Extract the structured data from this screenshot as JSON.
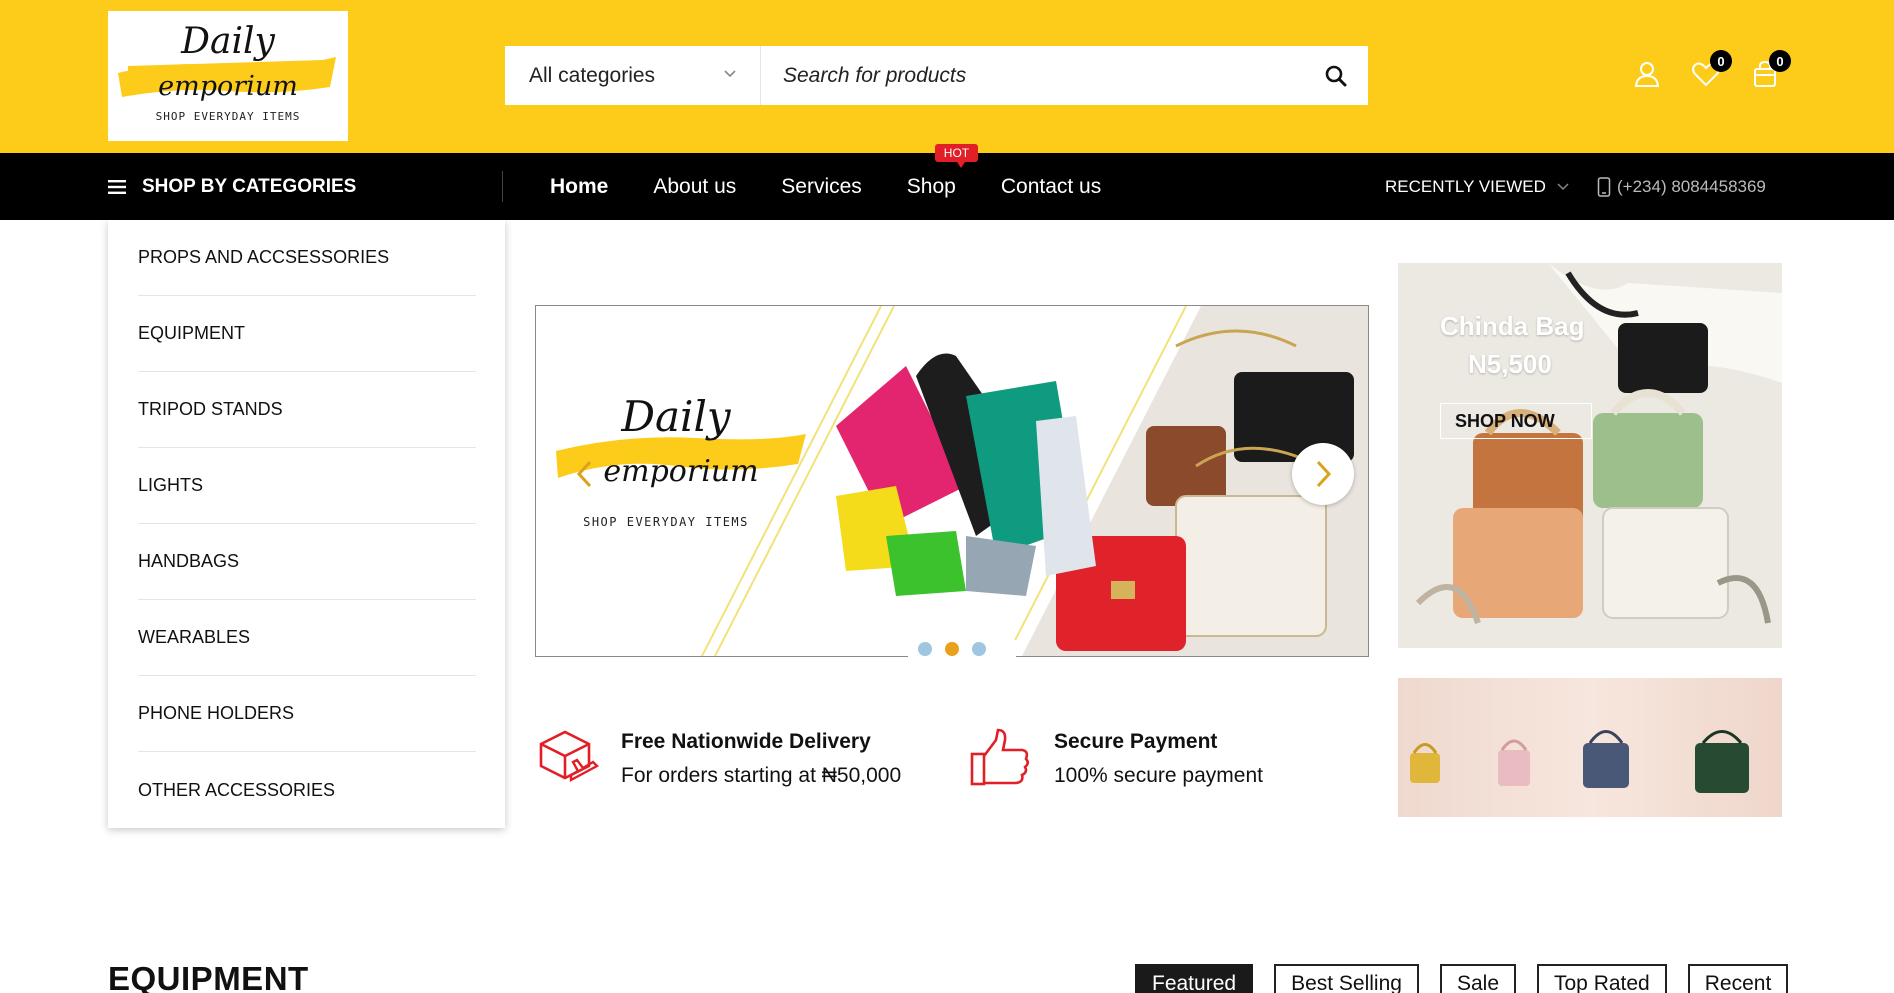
{
  "header": {
    "logo": {
      "line1": "Daily",
      "line2": "emporium",
      "tagline": "SHOP EVERYDAY ITEMS"
    },
    "search": {
      "category": "All categories",
      "placeholder": "Search for products"
    },
    "wishlist_count": "0",
    "cart_count": "0",
    "icons": [
      "user-icon",
      "heart-icon",
      "shopping-bag-icon",
      "search-icon",
      "chevron-down-icon"
    ]
  },
  "nav": {
    "shop_by_categories": "SHOP BY CATEGORIES",
    "links": [
      "Home",
      "About us",
      "Services",
      "Shop",
      "Contact us"
    ],
    "hot_badge": "HOT",
    "recently_viewed": "RECENTLY VIEWED",
    "phone": "(+234) 8084458369"
  },
  "categories": [
    "PROPS AND ACCSESSORIES",
    "EQUIPMENT",
    "TRIPOD STANDS",
    "LIGHTS",
    "HANDBAGS",
    "WEARABLES",
    "PHONE HOLDERS",
    "OTHER ACCESSORIES"
  ],
  "slider": {
    "logo": {
      "line1": "Daily",
      "line2": "emporium",
      "tagline": "SHOP EVERYDAY ITEMS"
    },
    "active_slide": 2,
    "slide_count": 3
  },
  "features": [
    {
      "title": "Free Nationwide Delivery",
      "subtitle": "For orders starting at ₦50,000",
      "icon": "delivery-box-plane-icon"
    },
    {
      "title": "Secure Payment",
      "subtitle": "100% secure payment",
      "icon": "thumbs-up-icon"
    }
  ],
  "banner": {
    "title": "Chinda Bag",
    "price": "N5,500",
    "button": "SHOP NOW"
  },
  "section": {
    "title": "EQUIPMENT",
    "tabs": [
      "Featured",
      "Best Selling",
      "Sale",
      "Top Rated",
      "Recent"
    ],
    "active_tab": "Featured"
  },
  "colors": {
    "brand_yellow": "#fdcb1a",
    "nav_black": "#000000",
    "hot_red": "#e21f26",
    "icon_red": "#e21f26",
    "dot_active": "#e8a11c",
    "dot_inactive": "#9fc6e0"
  }
}
